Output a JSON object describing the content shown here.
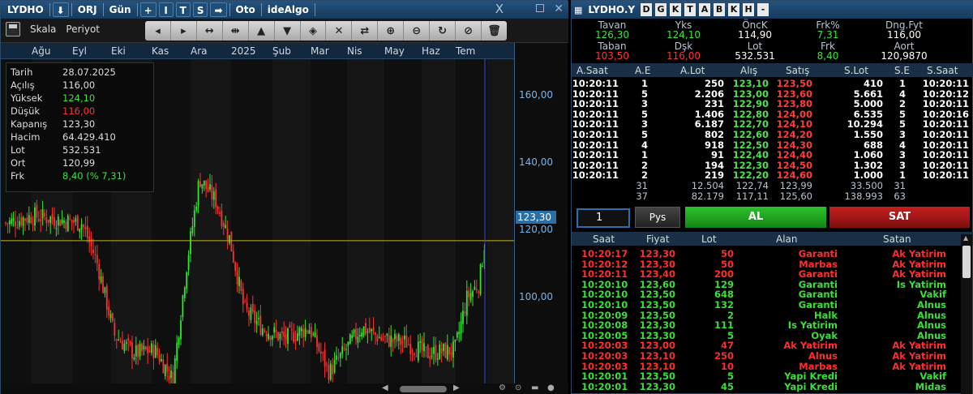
{
  "chart_window": {
    "symbol": "LYDHO",
    "down_icon": "download-icon",
    "orj": "ORJ",
    "period": "Gün",
    "toolbar_keys": [
      "+",
      "I",
      "T",
      "S"
    ],
    "arrow": "➡",
    "oto": "Oto",
    "idealgo": "ideAlgo",
    "close_label": "X",
    "menu": {
      "scale": "Skala",
      "period": "Periyot"
    },
    "tools": [
      "◂",
      "▸",
      "↔",
      "⇹",
      "▲",
      "▼",
      "◈",
      "✕",
      "⇄",
      "⊕",
      "⊖",
      "↻",
      "⊘",
      "🗑"
    ]
  },
  "months": [
    "Ağu",
    "Eyl",
    "Eki",
    "Kas",
    "Ara",
    "2025",
    "Şub",
    "Mar",
    "Nis",
    "May",
    "Haz",
    "Tem"
  ],
  "price_axis": [
    "160,00",
    "140,00",
    "120,00",
    "100,00"
  ],
  "last_price": "123,30",
  "info": [
    {
      "k": "Tarih",
      "v": "28.07.2025",
      "color": "#dddddd"
    },
    {
      "k": "Açılış",
      "v": "116,00",
      "color": "#dddddd"
    },
    {
      "k": "Yüksek",
      "v": "124,10",
      "color": "#3fe03f"
    },
    {
      "k": "Düşük",
      "v": "116,00",
      "color": "#ff3333"
    },
    {
      "k": "Kapanış",
      "v": "123,30",
      "color": "#dddddd"
    },
    {
      "k": "Hacim",
      "v": "64.429.410",
      "color": "#dddddd"
    },
    {
      "k": "Lot",
      "v": "532.531",
      "color": "#dddddd"
    },
    {
      "k": "Ort",
      "v": "120,99",
      "color": "#dddddd"
    },
    {
      "k": "Frk",
      "v": "8,40 (% 7,31)",
      "color": "#3fe03f"
    }
  ],
  "chart_data": {
    "type": "candlestick",
    "last": 123.3,
    "ylim": [
      85,
      172
    ],
    "guide_level": 123.3,
    "months": [
      "Ağu",
      "Eyl",
      "Eki",
      "Kas",
      "Ara",
      "2025",
      "Şub",
      "Mar",
      "Nis",
      "May",
      "Haz",
      "Tem"
    ]
  },
  "depth_window": {
    "symbol": "LYDHO.Y",
    "letters": [
      "D",
      "G",
      "K",
      "T",
      "A",
      "B",
      "K",
      "H",
      "-"
    ],
    "quote": [
      {
        "label": "Tavan",
        "value": "126,30",
        "color": "#3fe03f"
      },
      {
        "label": "Yks",
        "value": "124,10",
        "color": "#3fe03f"
      },
      {
        "label": "ÖncK",
        "value": "114,90",
        "color": "#ffffff"
      },
      {
        "label": "Frk%",
        "value": "7,31",
        "color": "#3fe03f"
      },
      {
        "label": "Dng.Fyt",
        "value": "116,00",
        "color": "#ffffff"
      },
      {
        "label": "Taban",
        "value": "103,50",
        "color": "#ff3333"
      },
      {
        "label": "Dşk",
        "value": "116,00",
        "color": "#ff3333"
      },
      {
        "label": "Lot",
        "value": "532.531",
        "color": "#ffffff"
      },
      {
        "label": "Frk",
        "value": "8,40",
        "color": "#3fe03f"
      },
      {
        "label": "Aort",
        "value": "120,9870",
        "color": "#ffffff"
      }
    ],
    "headers": [
      "A.Saat",
      "A.E",
      "A.Lot",
      "Alış",
      "Satış",
      "S.Lot",
      "S.E",
      "S.Saat"
    ],
    "rows": [
      [
        "10:20:11",
        "1",
        "250",
        "123,10",
        "123,50",
        "410",
        "1",
        "10:20:11"
      ],
      [
        "10:20:11",
        "5",
        "2.206",
        "123,00",
        "123,60",
        "5.661",
        "4",
        "10:20:12"
      ],
      [
        "10:20:11",
        "3",
        "231",
        "122,90",
        "123,80",
        "5.000",
        "2",
        "10:20:11"
      ],
      [
        "10:20:11",
        "5",
        "1.406",
        "122,80",
        "124,00",
        "6.535",
        "5",
        "10:20:16"
      ],
      [
        "10:20:11",
        "3",
        "6.187",
        "122,70",
        "124,10",
        "10.294",
        "5",
        "10:20:11"
      ],
      [
        "10:20:11",
        "5",
        "802",
        "122,60",
        "124,20",
        "1.550",
        "3",
        "10:20:11"
      ],
      [
        "10:20:11",
        "4",
        "918",
        "122,50",
        "124,30",
        "688",
        "4",
        "10:20:11"
      ],
      [
        "10:20:11",
        "1",
        "91",
        "122,40",
        "124,40",
        "1.060",
        "3",
        "10:20:11"
      ],
      [
        "10:20:11",
        "2",
        "194",
        "122,30",
        "124,50",
        "1.302",
        "3",
        "10:20:11"
      ],
      [
        "10:20:11",
        "2",
        "219",
        "122,20",
        "124,60",
        "1.000",
        "1",
        "10:20:11"
      ]
    ],
    "totals": [
      [
        "",
        "31",
        "12.504",
        "122,74",
        "123,99",
        "33.500",
        "31",
        ""
      ],
      [
        "",
        "37",
        "82.179",
        "117,11",
        "125,60",
        "138.993",
        "63",
        ""
      ]
    ],
    "qty": "1",
    "pys": "Pys",
    "buy": "AL",
    "sell": "SAT",
    "trade_headers": [
      "Saat",
      "Fiyat",
      "Lot",
      "Alan",
      "Satan"
    ],
    "trades": [
      [
        "10:20:17",
        "123,30",
        "50",
        "Garanti",
        "Ak Yatirim",
        "r"
      ],
      [
        "10:20:12",
        "123,30",
        "50",
        "Marbas",
        "Ak Yatirim",
        "r"
      ],
      [
        "10:20:11",
        "123,40",
        "200",
        "Garanti",
        "Ak Yatirim",
        "r"
      ],
      [
        "10:20:10",
        "123,60",
        "129",
        "Garanti",
        "Is Yatirim",
        "g"
      ],
      [
        "10:20:10",
        "123,50",
        "648",
        "Garanti",
        "Vakif",
        "g"
      ],
      [
        "10:20:10",
        "123,50",
        "132",
        "Garanti",
        "Alnus",
        "g"
      ],
      [
        "10:20:09",
        "123,50",
        "2",
        "Halk",
        "Alnus",
        "g"
      ],
      [
        "10:20:08",
        "123,30",
        "111",
        "Is Yatirim",
        "Alnus",
        "g"
      ],
      [
        "10:20:05",
        "123,30",
        "5",
        "Oyak",
        "Alnus",
        "g"
      ],
      [
        "10:20:03",
        "123,00",
        "47",
        "Ak Yatirim",
        "Ak Yatirim",
        "r"
      ],
      [
        "10:20:03",
        "123,10",
        "250",
        "Alnus",
        "Ak Yatirim",
        "r"
      ],
      [
        "10:20:03",
        "123,10",
        "10",
        "Marbas",
        "Ak Yatirim",
        "r"
      ],
      [
        "10:20:01",
        "123,50",
        "5",
        "Yapi Kredi",
        "Vakif",
        "g"
      ],
      [
        "10:20:01",
        "123,30",
        "45",
        "Yapi Kredi",
        "Midas",
        "g"
      ]
    ]
  }
}
